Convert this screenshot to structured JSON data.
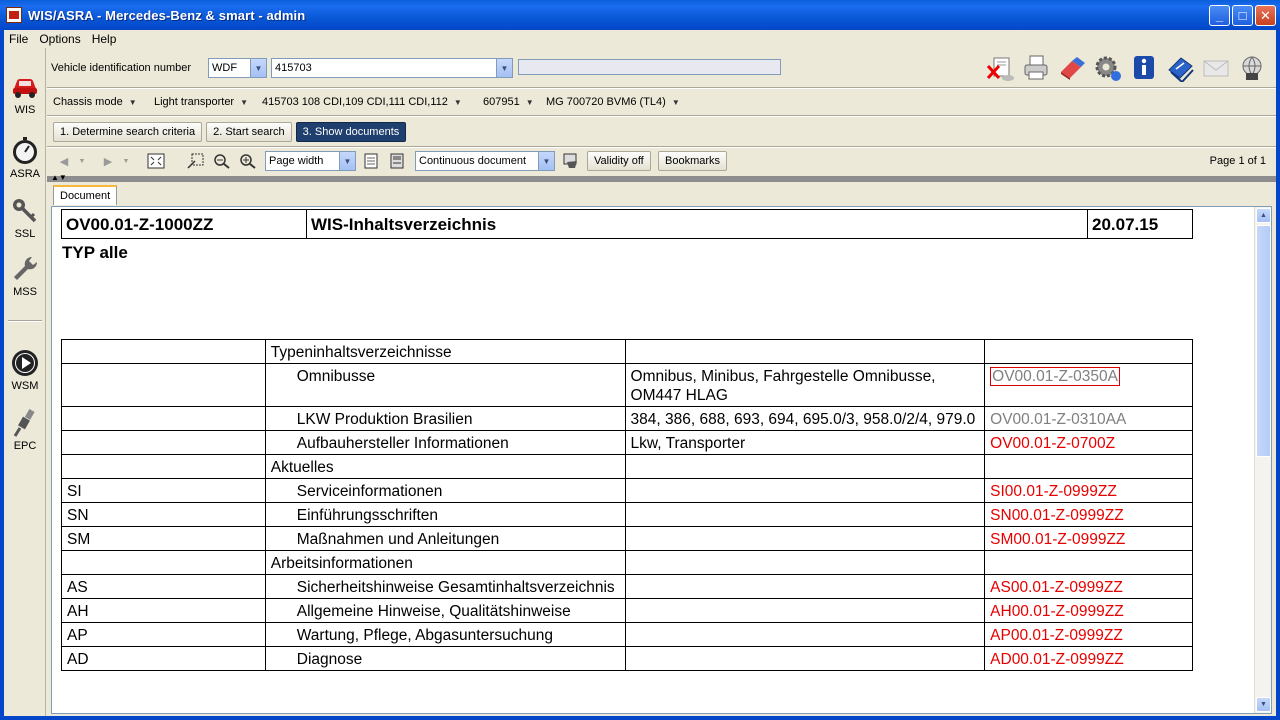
{
  "window": {
    "title": "WIS/ASRA - Mercedes-Benz & smart - admin",
    "buttons": [
      "minimize",
      "maximize",
      "close"
    ]
  },
  "menu": [
    "File",
    "Options",
    "Help"
  ],
  "sidebar": {
    "items": [
      {
        "label": "WIS",
        "icon": "car-icon"
      },
      {
        "label": "ASRA",
        "icon": "stopwatch-icon"
      },
      {
        "label": "SSL",
        "icon": "key-icon"
      },
      {
        "label": "MSS",
        "icon": "wrench-icon"
      },
      {
        "label": "WSM",
        "icon": "play-icon"
      },
      {
        "label": "EPC",
        "icon": "spark-plug-icon"
      }
    ]
  },
  "vehicle": {
    "label": "Vehicle identification number",
    "prefix": "WDF",
    "number": "415703",
    "status": ""
  },
  "toolbar_icons": [
    "delete-vehicle-icon",
    "print-icon",
    "eraser-icon",
    "settings-icon",
    "info-icon",
    "manual-icon",
    "mail-icon",
    "network-icon"
  ],
  "chassis": [
    "Chassis mode",
    "Light transporter",
    "415703 108 CDI,109 CDI,111 CDI,112",
    "607951",
    "MG 700720 BVM6 (TL4)"
  ],
  "steps": [
    "1. Determine search criteria",
    "2. Start search",
    "3. Show documents"
  ],
  "doc_toolbar": {
    "zoom": "Page width",
    "view_mode": "Continuous document",
    "validity_button": "Validity off",
    "bookmarks_button": "Bookmarks",
    "page_label": "Page",
    "page_current": "1",
    "page_of": "of",
    "page_total": "1"
  },
  "tabs": [
    "Document"
  ],
  "document": {
    "header_code": "OV00.01-Z-1000ZZ",
    "header_title": "WIS-Inhaltsverzeichnis",
    "header_date": "20.07.15",
    "typ": "TYP alle",
    "rows": [
      {
        "code": "",
        "title": "Typeninhaltsverzeichnisse",
        "indent": false,
        "desc": "",
        "ref": "",
        "style": "none"
      },
      {
        "code": "",
        "title": "Omnibusse",
        "indent": true,
        "desc": "Omnibus, Minibus, Fahrgestelle Omnibusse, OM447 HLAG",
        "ref": "OV00.01-Z-0350A",
        "style": "grey-boxed"
      },
      {
        "code": "",
        "title": "LKW Produktion Brasilien",
        "indent": true,
        "desc": "384, 386, 688, 693, 694, 695.0/3, 958.0/2/4, 979.0",
        "ref": "OV00.01-Z-0310AA",
        "style": "grey"
      },
      {
        "code": "",
        "title": "Aufbauhersteller Informationen",
        "indent": true,
        "desc": "Lkw, Transporter",
        "ref": "OV00.01-Z-0700Z",
        "style": "red"
      },
      {
        "code": "",
        "title": "Aktuelles",
        "indent": false,
        "desc": "",
        "ref": "",
        "style": "none"
      },
      {
        "code": "SI",
        "title": "Serviceinformationen",
        "indent": true,
        "desc": "",
        "ref": "SI00.01-Z-0999ZZ",
        "style": "red"
      },
      {
        "code": "SN",
        "title": "Einführungsschriften",
        "indent": true,
        "desc": "",
        "ref": "SN00.01-Z-0999ZZ",
        "style": "red"
      },
      {
        "code": "SM",
        "title": "Maßnahmen und Anleitungen",
        "indent": true,
        "desc": "",
        "ref": "SM00.01-Z-0999ZZ",
        "style": "red"
      },
      {
        "code": "",
        "title": "Arbeitsinformationen",
        "indent": false,
        "desc": "",
        "ref": "",
        "style": "none"
      },
      {
        "code": "AS",
        "title": "Sicherheitshinweise Gesamtinhaltsverzeichnis",
        "indent": true,
        "desc": "",
        "ref": "AS00.01-Z-0999ZZ",
        "style": "red"
      },
      {
        "code": "AH",
        "title": "Allgemeine Hinweise, Qualitätshinweise",
        "indent": true,
        "desc": "",
        "ref": "AH00.01-Z-0999ZZ",
        "style": "red"
      },
      {
        "code": "AP",
        "title": "Wartung, Pflege, Abgasuntersuchung",
        "indent": true,
        "desc": "",
        "ref": "AP00.01-Z-0999ZZ",
        "style": "red"
      },
      {
        "code": "AD",
        "title": "Diagnose",
        "indent": true,
        "desc": "",
        "ref": "AD00.01-Z-0999ZZ",
        "style": "red"
      }
    ]
  },
  "colors": {
    "titlebar": "#0a5fd9",
    "active_step": "#1f3f6e",
    "link_red": "#e60000",
    "link_grey": "#808080"
  }
}
